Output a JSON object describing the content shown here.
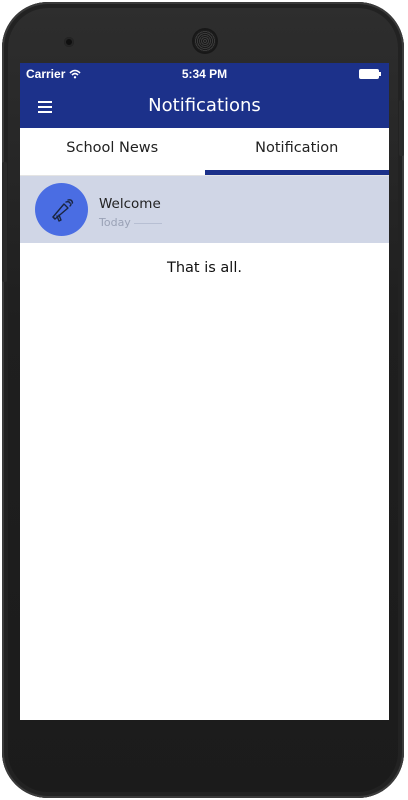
{
  "status_bar": {
    "carrier": "Carrier",
    "time": "5:34 PM"
  },
  "nav_bar": {
    "title": "Notifications"
  },
  "tabs": [
    {
      "label": "School News",
      "active": false
    },
    {
      "label": "Notification",
      "active": true
    }
  ],
  "notifications": [
    {
      "title": "Welcome",
      "date": "Today",
      "icon": "megaphone-icon"
    }
  ],
  "end_message": "That is all.",
  "colors": {
    "brand": "#1c318a",
    "avatar": "#4a6de3",
    "selected_row": "#d0d6e6"
  }
}
